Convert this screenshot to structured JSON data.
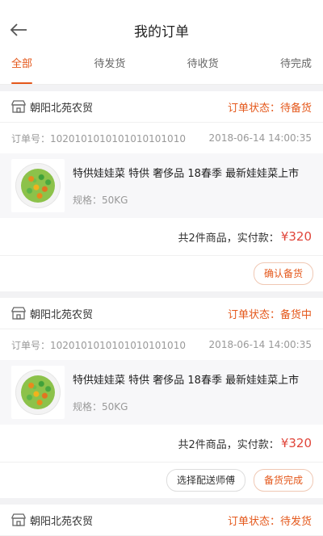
{
  "header": {
    "title": "我的订单",
    "back_icon": "arrow-left-icon"
  },
  "tabs": [
    {
      "label": "全部"
    },
    {
      "label": "待发货"
    },
    {
      "label": "待收货"
    },
    {
      "label": "待完成"
    }
  ],
  "colors": {
    "accent": "#e4571a",
    "price": "#e0453a"
  },
  "orders": [
    {
      "shop": "朝阳北苑农贸",
      "status": "订单状态：待备货",
      "order_no": "订单号：1020101010101010101010",
      "time": "2018-06-14  14:00:35",
      "goods_name": "特供娃娃菜 特供 奢侈品 18春季   最新娃娃菜上市",
      "goods_spec": "规格：50KG",
      "summary_label": "共2件商品，实付款：",
      "price": "¥320",
      "buttons": [
        "确认备货"
      ]
    },
    {
      "shop": "朝阳北苑农贸",
      "status": "订单状态：备货中",
      "order_no": "订单号：1020101010101010101010",
      "time": "2018-06-14  14:00:35",
      "goods_name": "特供娃娃菜 特供 奢侈品 18春季   最新娃娃菜上市",
      "goods_spec": "规格：50KG",
      "summary_label": "共2件商品，实付款：",
      "price": "¥320",
      "buttons": [
        "选择配送师傅",
        "备货完成"
      ]
    },
    {
      "shop": "朝阳北苑农贸",
      "status": "订单状态：待发货"
    }
  ]
}
